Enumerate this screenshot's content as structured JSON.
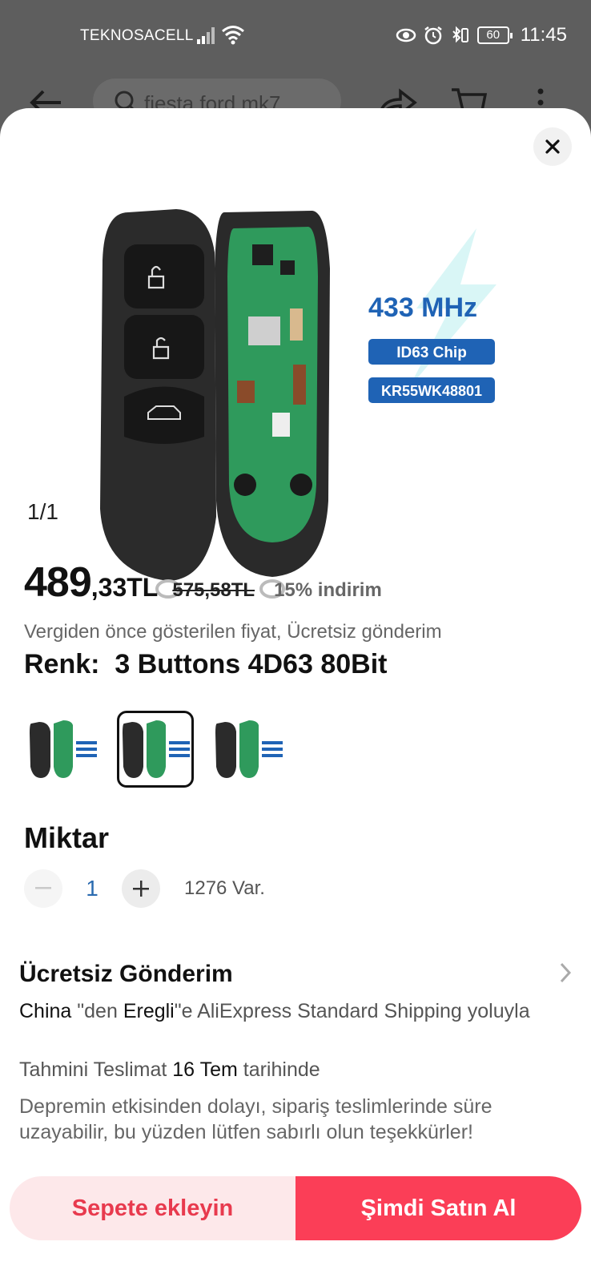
{
  "status_bar": {
    "carrier": "TEKNOSACELL",
    "battery": "60",
    "time": "11:45"
  },
  "background_header": {
    "search_placeholder": "fiesta ford mk7"
  },
  "product": {
    "image_counter": "1/1",
    "image_labels": {
      "frequency": "433 MHz",
      "chip": "ID63 Chip",
      "model": "KR55WK48801"
    },
    "price_integer": "489",
    "price_decimal": ",33TL",
    "price_original": "575,58TL",
    "discount": "15% indirim",
    "tax_note": "Vergiden önce gösterilen fiyat, Ücretsiz gönderim",
    "color_label": "Renk:",
    "color_value": "3 Buttons 4D63 80Bit"
  },
  "quantity": {
    "title": "Miktar",
    "value": "1",
    "stock": "1276 Var."
  },
  "shipping": {
    "title": "Ücretsiz Gönderim",
    "origin": "China",
    "sep1": " \"den ",
    "destination": "Eregli",
    "sep2": "\"e AliExpress Standard Shipping yoluyla",
    "delivery_prefix": "Tahmini Teslimat ",
    "delivery_date": "16 Tem",
    "delivery_suffix": " tarihinde",
    "notice": "Depremin etkisinden dolayı, sipariş teslimlerinde süre uzayabilir, bu yüzden lütfen sabırlı olun teşekkürler!"
  },
  "actions": {
    "add_to_cart": "Sepete ekleyin",
    "buy_now": "Şimdi Satın Al"
  },
  "colors": {
    "accent": "#fb3e57",
    "cart_bg": "#fde8ea",
    "pcb_green": "#2f9a5c",
    "label_blue": "#1f63b5"
  }
}
